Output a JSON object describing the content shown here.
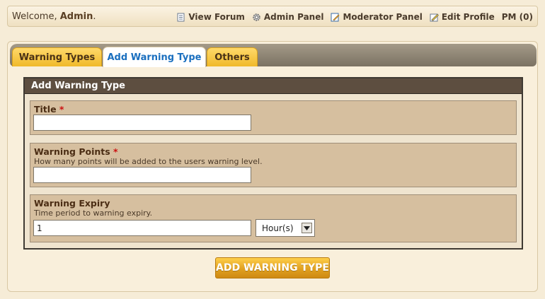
{
  "topbar": {
    "welcome_prefix": "Welcome,",
    "user_name": "Admin",
    "welcome_suffix": ".",
    "links": [
      {
        "label": "View Forum",
        "icon": "document-icon"
      },
      {
        "label": "Admin Panel",
        "icon": "gear-icon"
      },
      {
        "label": "Moderator Panel",
        "icon": "moderator-icon"
      },
      {
        "label": "Edit Profile",
        "icon": "edit-icon"
      },
      {
        "label": "PM (0)",
        "icon": ""
      }
    ]
  },
  "tabs": [
    {
      "label": "Warning Types",
      "active": false
    },
    {
      "label": "Add Warning Type",
      "active": true
    },
    {
      "label": "Others",
      "active": false
    }
  ],
  "form": {
    "heading": "Add Warning Type",
    "title_field": {
      "label": "Title",
      "required_mark": "*",
      "value": ""
    },
    "points_field": {
      "label": "Warning Points",
      "required_mark": "*",
      "description": "How many points will be added to the users warning level.",
      "value": ""
    },
    "expiry_field": {
      "label": "Warning Expiry",
      "description": "Time period to warning expiry.",
      "value": "1",
      "unit_selected": "Hour(s)"
    },
    "submit_label": "ADD WARNING TYPE"
  },
  "colors": {
    "accent_tab": "#f0b92a",
    "active_tab_text": "#1a6fbf",
    "form_header": "#5d4e40",
    "required": "#cc1111"
  }
}
